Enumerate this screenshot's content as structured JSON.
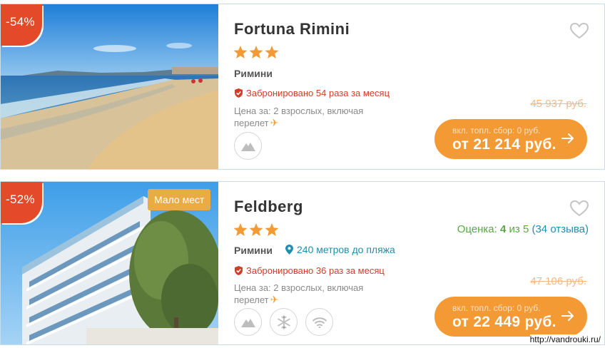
{
  "colors": {
    "discount": "#e44a29",
    "button": "#f39a35",
    "badge": "#e9ac45",
    "booked": "#d23d2a",
    "rating": "#5aa845",
    "link": "#1f8fb0"
  },
  "hotels": [
    {
      "discount": "-54%",
      "name": "Fortuna Rimini",
      "stars": 3,
      "city": "Римини",
      "booked": "Забронировано 54 раза за месяц",
      "price_for_line1": "Цена за: 2 взрослых, включая",
      "price_for_line2": "перелет",
      "old_price": "45 937 руб.",
      "fee_note": "вкл. топл. сбор: 0 руб.",
      "price": "от 21 214 руб.",
      "amenities": [
        "mountain-icon"
      ]
    },
    {
      "discount": "-52%",
      "badge": "Мало мест",
      "name": "Feldberg",
      "stars": 3,
      "city": "Римини",
      "beach_distance": "240 метров до пляжа",
      "rating_label": "Оценка:",
      "rating_score": "4",
      "rating_scale": "из 5",
      "rating_reviews": "(34 отзыва)",
      "booked": "Забронировано 36 раз за месяц",
      "price_for_line1": "Цена за: 2 взрослых, включая",
      "price_for_line2": "перелет",
      "old_price": "47 106 руб.",
      "fee_note": "вкл. топл. сбор: 0 руб.",
      "price": "от 22 449 руб.",
      "amenities": [
        "mountain-icon",
        "snowflake-icon",
        "wifi-icon"
      ]
    }
  ],
  "watermark": "http://vandrouki.ru/"
}
